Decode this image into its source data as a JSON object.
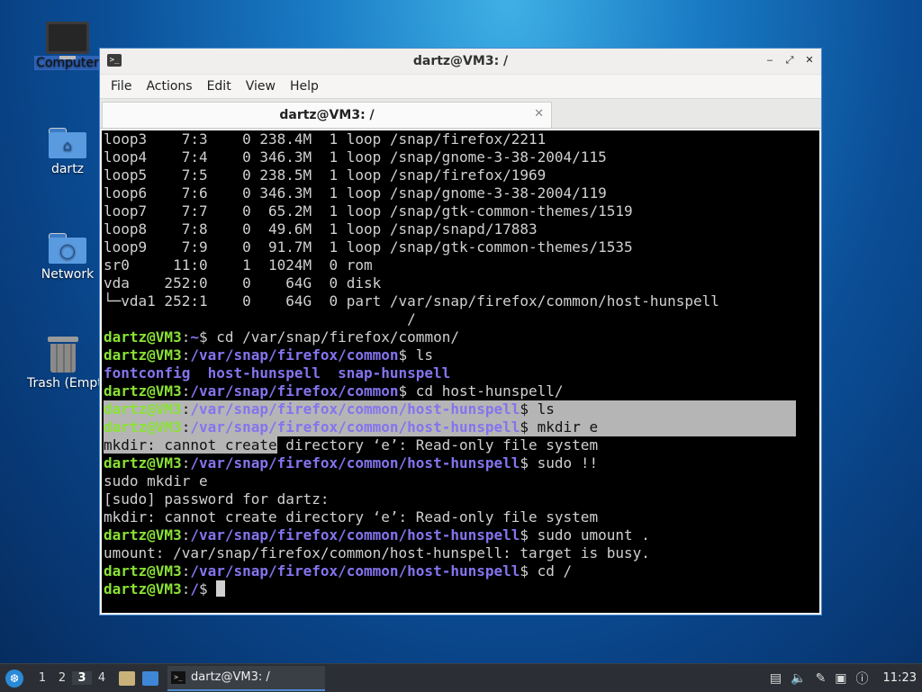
{
  "desktop": {
    "icons": [
      {
        "label": "Computer"
      },
      {
        "label": "dartz"
      },
      {
        "label": "Network"
      },
      {
        "label": "Trash (Empty)"
      }
    ]
  },
  "window": {
    "title": "dartz@VM3: /",
    "menu": [
      "File",
      "Actions",
      "Edit",
      "View",
      "Help"
    ],
    "tab_label": "dartz@VM3: /",
    "controls": {
      "minimize": "‒",
      "maximize": "⤢",
      "close": "✕"
    }
  },
  "terminal": {
    "lines": [
      {
        "plain": "loop3    7:3    0 238.4M  1 loop /snap/firefox/2211"
      },
      {
        "plain": "loop4    7:4    0 346.3M  1 loop /snap/gnome-3-38-2004/115"
      },
      {
        "plain": "loop5    7:5    0 238.5M  1 loop /snap/firefox/1969"
      },
      {
        "plain": "loop6    7:6    0 346.3M  1 loop /snap/gnome-3-38-2004/119"
      },
      {
        "plain": "loop7    7:7    0  65.2M  1 loop /snap/gtk-common-themes/1519"
      },
      {
        "plain": "loop8    7:8    0  49.6M  1 loop /snap/snapd/17883"
      },
      {
        "plain": "loop9    7:9    0  91.7M  1 loop /snap/gtk-common-themes/1535"
      },
      {
        "plain": "sr0     11:0    1  1024M  0 rom"
      },
      {
        "plain": "vda    252:0    0    64G  0 disk"
      },
      {
        "plain": "└─vda1 252:1    0    64G  0 part /var/snap/firefox/common/host-hunspell"
      },
      {
        "plain": "                                   /"
      },
      {
        "user": "dartz@VM3",
        "path": "~",
        "cmd": "$ cd /var/snap/firefox/common/"
      },
      {
        "user": "dartz@VM3",
        "path": "/var/snap/firefox/common",
        "cmd": "$ ls"
      },
      {
        "dirs": "fontconfig  host-hunspell  snap-hunspell"
      },
      {
        "user": "dartz@VM3",
        "path": "/var/snap/firefox/common",
        "cmd": "$ cd host-hunspell/"
      },
      {
        "user": "dartz@VM3",
        "path": "/var/snap/firefox/common/host-hunspell",
        "cmd": "$ ls",
        "highlight": true
      },
      {
        "user": "dartz@VM3",
        "path": "/var/snap/firefox/common/host-hunspell",
        "cmd": "$ mkdir e",
        "highlight": true
      },
      {
        "sel": "mkdir: cannot create",
        "rest": " directory ‘e’: Read-only file system"
      },
      {
        "user": "dartz@VM3",
        "path": "/var/snap/firefox/common/host-hunspell",
        "cmd": "$ sudo !!"
      },
      {
        "plain": "sudo mkdir e"
      },
      {
        "plain": "[sudo] password for dartz:"
      },
      {
        "plain": "mkdir: cannot create directory ‘e’: Read-only file system"
      },
      {
        "user": "dartz@VM3",
        "path": "/var/snap/firefox/common/host-hunspell",
        "cmd": "$ sudo umount ."
      },
      {
        "plain": "umount: /var/snap/firefox/common/host-hunspell: target is busy."
      },
      {
        "user": "dartz@VM3",
        "path": "/var/snap/firefox/common/host-hunspell",
        "cmd": "$ cd /"
      },
      {
        "user": "dartz@VM3",
        "path": "/",
        "cmd": "$ ",
        "cursor": true
      }
    ]
  },
  "taskbar": {
    "workspaces": [
      "1",
      "2",
      "3",
      "4"
    ],
    "active_workspace": "3",
    "task_label": "dartz@VM3: /",
    "clock": "11:23"
  }
}
